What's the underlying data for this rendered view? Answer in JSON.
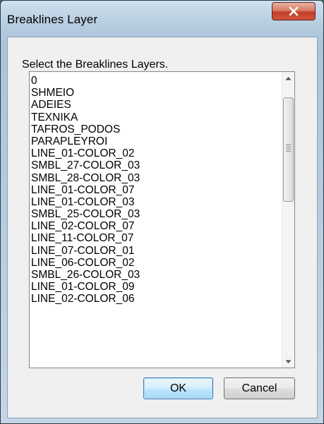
{
  "window": {
    "title": "Breaklines Layer",
    "close_icon": "close-x-icon",
    "close_color": "#c7432b"
  },
  "dialog": {
    "prompt": "Select the Breaklines Layers.",
    "layers": [
      "0",
      "SHMEIO",
      "ADEIES",
      "TEXNIKA",
      "TAFROS_PODOS",
      "PARAPLEYROI",
      "LINE_01-COLOR_02",
      "SMBL_27-COLOR_03",
      "SMBL_28-COLOR_03",
      "LINE_01-COLOR_07",
      "LINE_01-COLOR_03",
      "SMBL_25-COLOR_03",
      "LINE_02-COLOR_07",
      "LINE_11-COLOR_07",
      "LINE_07-COLOR_01",
      "LINE_06-COLOR_02",
      "SMBL_26-COLOR_03",
      "LINE_01-COLOR_09",
      "LINE_02-COLOR_06"
    ],
    "ok_label": "OK",
    "cancel_label": "Cancel",
    "ok_accent": "#3c7fb1"
  }
}
